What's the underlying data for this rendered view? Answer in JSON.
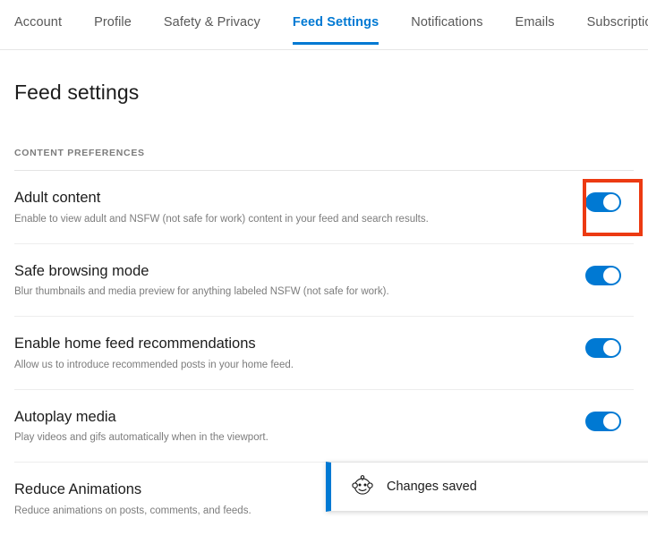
{
  "tabs": [
    {
      "label": "Account",
      "active": false
    },
    {
      "label": "Profile",
      "active": false
    },
    {
      "label": "Safety & Privacy",
      "active": false
    },
    {
      "label": "Feed Settings",
      "active": true
    },
    {
      "label": "Notifications",
      "active": false
    },
    {
      "label": "Emails",
      "active": false
    },
    {
      "label": "Subscriptions",
      "active": false
    }
  ],
  "page": {
    "title": "Feed settings",
    "section_label": "CONTENT PREFERENCES"
  },
  "settings": [
    {
      "title": "Adult content",
      "description": "Enable to view adult and NSFW (not safe for work) content in your feed and search results.",
      "toggle_state": "on",
      "highlighted": true
    },
    {
      "title": "Safe browsing mode",
      "description": "Blur thumbnails and media preview for anything labeled NSFW (not safe for work).",
      "toggle_state": "on",
      "highlighted": false
    },
    {
      "title": "Enable home feed recommendations",
      "description": "Allow us to introduce recommended posts in your home feed.",
      "toggle_state": "on",
      "highlighted": false
    },
    {
      "title": "Autoplay media",
      "description": "Play videos and gifs automatically when in the viewport.",
      "toggle_state": "on",
      "highlighted": false
    },
    {
      "title": "Reduce Animations",
      "description": "Reduce animations on posts, comments, and feeds.",
      "toggle_state": "on",
      "highlighted": false
    }
  ],
  "toast": {
    "message": "Changes saved",
    "icon": "reddit-snoo-icon"
  },
  "colors": {
    "accent": "#0079d3",
    "highlight": "#ec3a12",
    "muted_text": "#7c7c7c"
  }
}
